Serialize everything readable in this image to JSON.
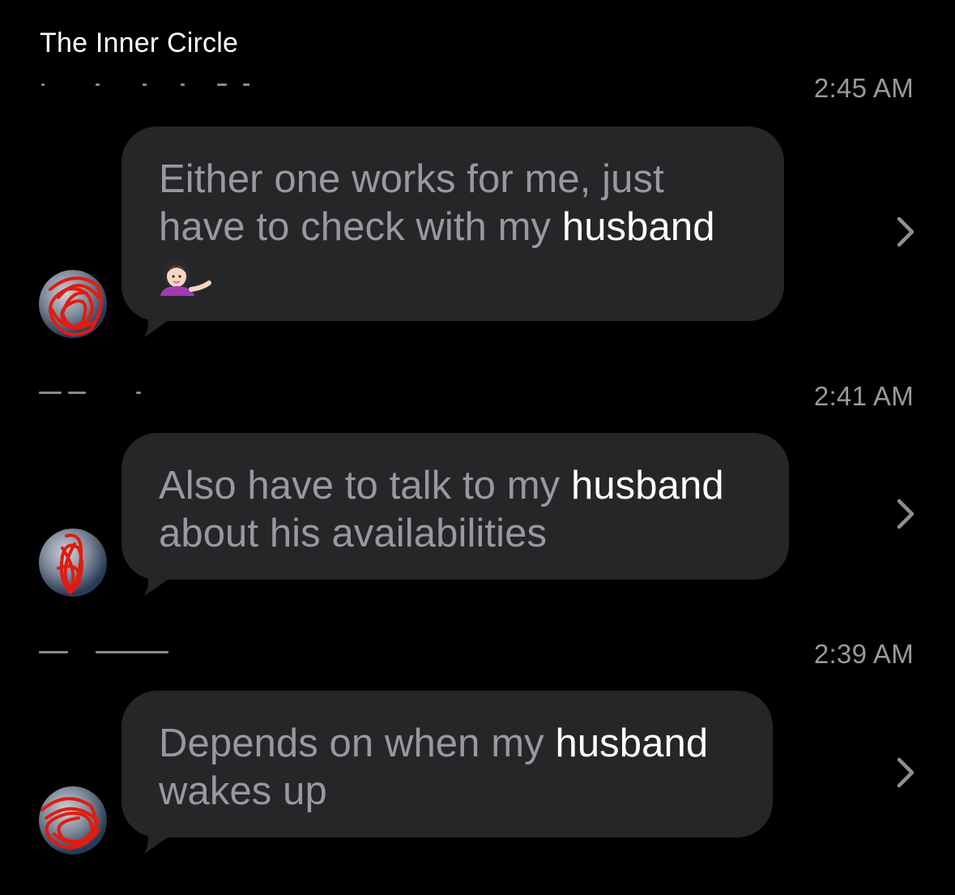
{
  "header": {
    "title": "The Inner Circle"
  },
  "colors": {
    "background": "#000000",
    "bubble": "#262628",
    "text_dim": "#98989f",
    "text_highlight": "#ffffff",
    "scribble": "#e21b12"
  },
  "messages": [
    {
      "time": "2:45 AM",
      "line1_a": "Either one works for me, just",
      "line2_a": "have to check with my ",
      "line2_hl": "husband",
      "emoji": "person-tipping-hand-emoji"
    },
    {
      "time": "2:41 AM",
      "line1_a": "Also have to talk to my ",
      "line1_hl": "husband",
      "line2_a": "about his availabilities"
    },
    {
      "time": "2:39 AM",
      "line1_a": "Depends on when my ",
      "line1_hl": "husband",
      "line2_a": "wakes up"
    }
  ]
}
